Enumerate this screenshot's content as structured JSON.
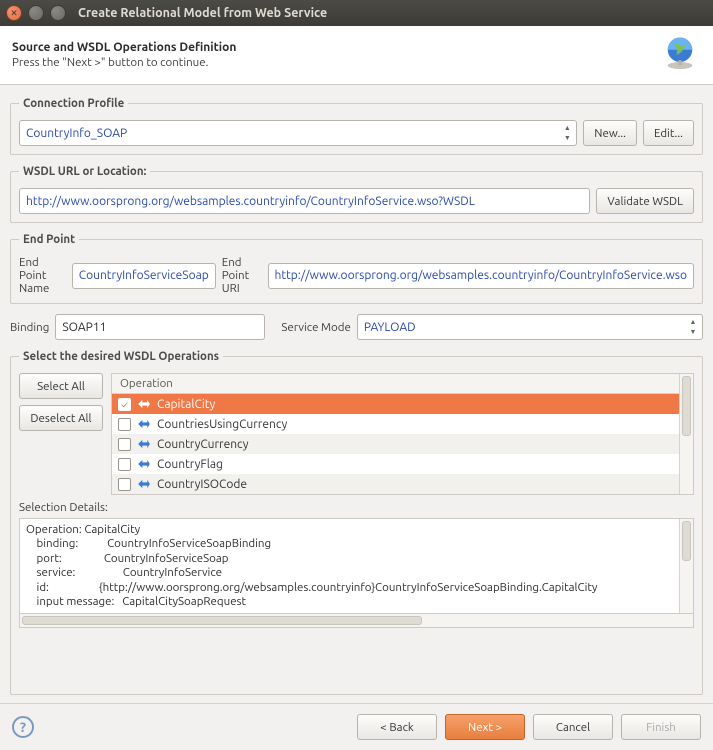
{
  "window": {
    "title": "Create Relational Model from Web Service"
  },
  "header": {
    "title": "Source and WSDL Operations Definition",
    "subtitle": "Press the \"Next >\" button to continue."
  },
  "connection_profile": {
    "legend": "Connection Profile",
    "value": "CountryInfo_SOAP",
    "new_label": "New...",
    "edit_label": "Edit..."
  },
  "wsdl": {
    "legend": "WSDL URL or Location:",
    "value": "http://www.oorsprong.org/websamples.countryinfo/CountryInfoService.wso?WSDL",
    "validate_label": "Validate WSDL"
  },
  "endpoint": {
    "legend": "End Point",
    "name_label": "End Point Name",
    "name_value": "CountryInfoServiceSoap",
    "uri_label": "End Point URI",
    "uri_value": "http://www.oorsprong.org/websamples.countryinfo/CountryInfoService.wso"
  },
  "binding": {
    "label": "Binding",
    "value": "SOAP11"
  },
  "service_mode": {
    "label": "Service Mode",
    "value": "PAYLOAD"
  },
  "operations": {
    "legend": "Select the desired WSDL Operations",
    "select_all": "Select All",
    "deselect_all": "Deselect All",
    "header": "Operation",
    "items": [
      {
        "name": "CapitalCity",
        "checked": true,
        "selected": true
      },
      {
        "name": "CountriesUsingCurrency",
        "checked": false,
        "selected": false
      },
      {
        "name": "CountryCurrency",
        "checked": false,
        "selected": false
      },
      {
        "name": "CountryFlag",
        "checked": false,
        "selected": false
      },
      {
        "name": "CountryISOCode",
        "checked": false,
        "selected": false
      }
    ]
  },
  "selection_details": {
    "label": "Selection Details:",
    "text": "Operation: CapitalCity\n    binding:           CountryInfoServiceSoapBinding\n    port:                CountryInfoServiceSoap\n    service:                  CountryInfoService\n    id:                   {http://www.oorsprong.org/websamples.countryinfo}CountryInfoServiceSoapBinding.CapitalCity\n    input message:   CapitalCitySoapRequest"
  },
  "footer": {
    "back": "< Back",
    "next": "Next >",
    "cancel": "Cancel",
    "finish": "Finish"
  }
}
